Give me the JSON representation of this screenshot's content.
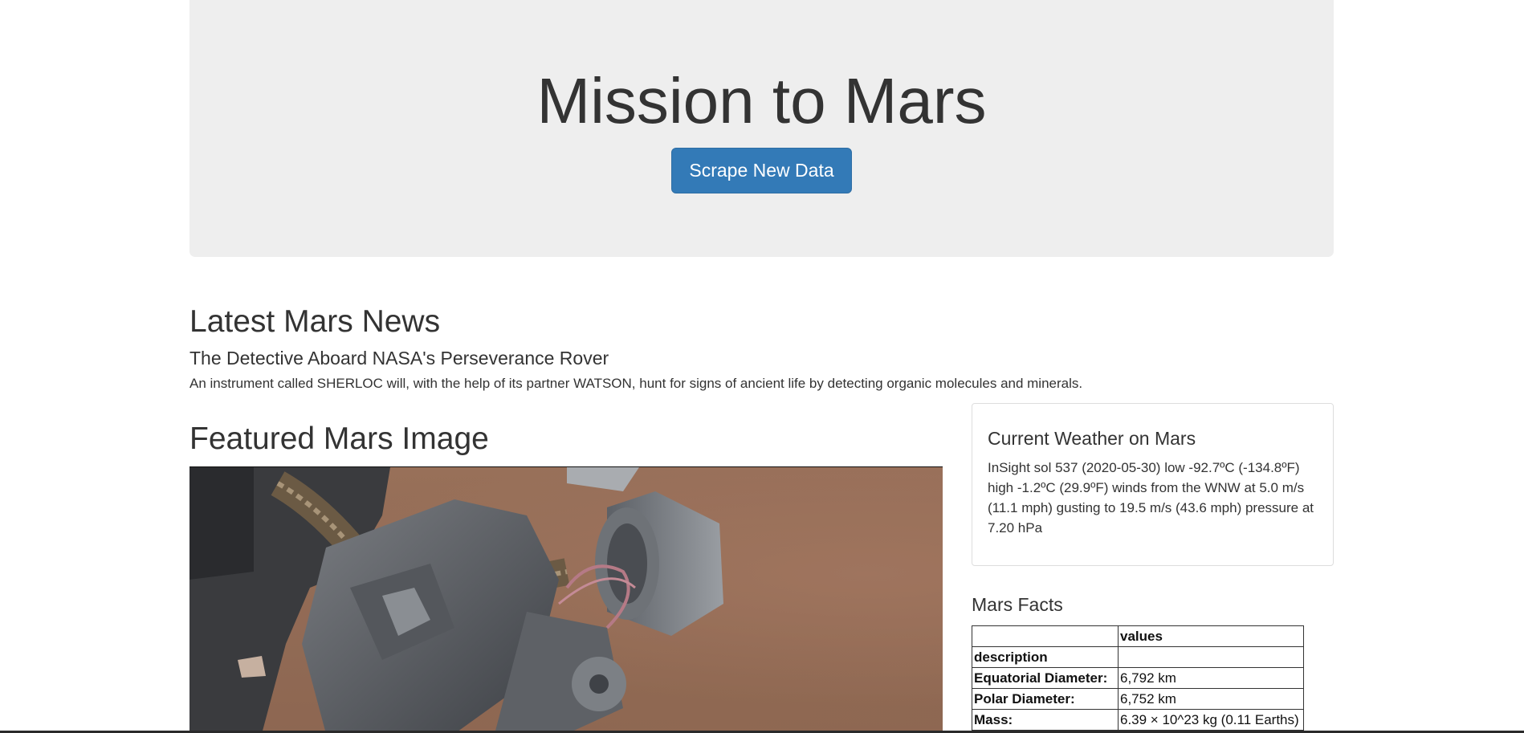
{
  "header": {
    "title": "Mission to Mars",
    "scrape_button_label": "Scrape New Data"
  },
  "news": {
    "section_title": "Latest Mars News",
    "headline": "The Detective Aboard NASA's Perseverance Rover",
    "teaser": "An instrument called SHERLOC will, with the help of its partner WATSON, hunt for signs of ancient life by detecting organic molecules and minerals."
  },
  "featured": {
    "section_title": "Featured Mars Image"
  },
  "weather": {
    "title": "Current Weather on Mars",
    "text": "InSight sol 537 (2020-05-30) low -92.7ºC (-134.8ºF) high -1.2ºC (29.9ºF) winds from the WNW at 5.0 m/s (11.1 mph) gusting to 19.5 m/s (43.6 mph) pressure at 7.20 hPa"
  },
  "facts": {
    "title": "Mars Facts",
    "header": [
      "",
      "values"
    ],
    "index_label": "description",
    "rows": [
      {
        "label": "Equatorial Diameter:",
        "value": "6,792 km"
      },
      {
        "label": "Polar Diameter:",
        "value": "6,752 km"
      },
      {
        "label": "Mass:",
        "value": "6.39 × 10^23 kg (0.11 Earths)"
      }
    ]
  },
  "colors": {
    "jumbotron_bg": "#eeeeee",
    "primary_button": "#337ab7",
    "text": "#333333"
  }
}
